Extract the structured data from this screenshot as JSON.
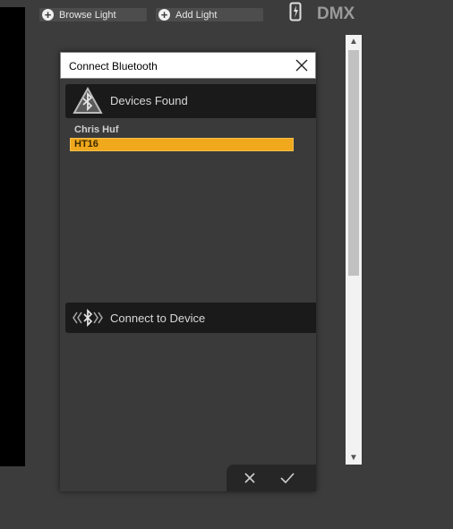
{
  "toolbar": {
    "browse_label": "Browse Light",
    "add_label": "Add Light",
    "logo_text": "DMX"
  },
  "dialog": {
    "title": "Connect Bluetooth",
    "devices_section_label": "Devices Found",
    "connect_section_label": "Connect to Device",
    "devices": [
      "Chris Huf",
      "HT16"
    ],
    "selected_device_index": 1
  },
  "colors": {
    "selection": "#f0a81d",
    "header_bg": "#1a1a1a",
    "dialog_bg": "#3a3a3a"
  },
  "icons": [
    "plus-circle-icon",
    "phone-lightning-icon",
    "bluetooth-warning-icon",
    "bluetooth-signal-icon",
    "close-icon",
    "cancel-x-icon",
    "check-icon",
    "scroll-up-icon",
    "scroll-down-icon"
  ]
}
